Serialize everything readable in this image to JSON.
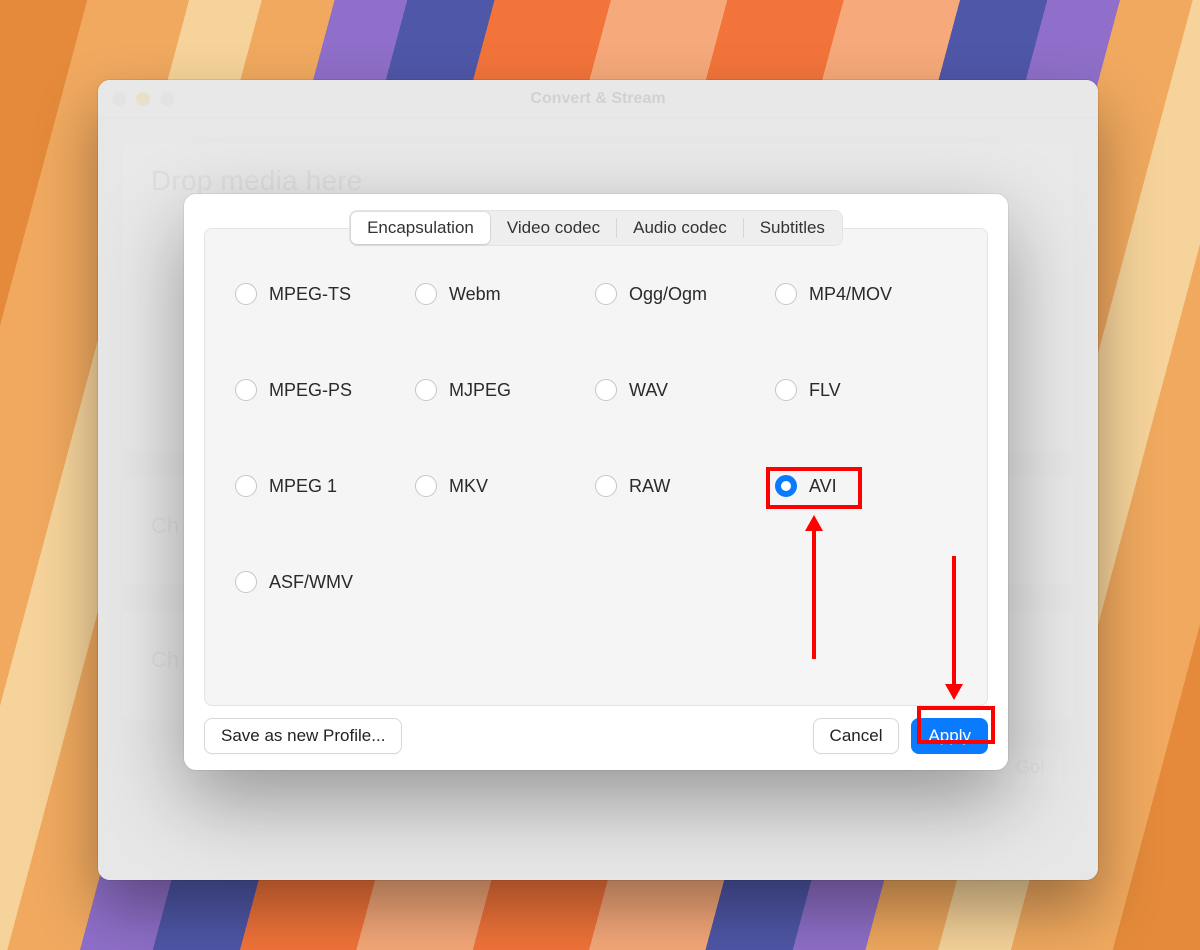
{
  "parent_window": {
    "title": "Convert & Stream",
    "drop_text": "Drop media here",
    "section_prefix": "Ch",
    "go_label": "Go!"
  },
  "sheet": {
    "tabs": {
      "encapsulation": "Encapsulation",
      "video_codec": "Video codec",
      "audio_codec": "Audio codec",
      "subtitles": "Subtitles",
      "active": "encapsulation"
    },
    "encapsulation_options": [
      {
        "id": "mpeg-ts",
        "label": "MPEG-TS",
        "selected": false
      },
      {
        "id": "webm",
        "label": "Webm",
        "selected": false
      },
      {
        "id": "ogg",
        "label": "Ogg/Ogm",
        "selected": false
      },
      {
        "id": "mp4",
        "label": "MP4/MOV",
        "selected": false
      },
      {
        "id": "mpeg-ps",
        "label": "MPEG-PS",
        "selected": false
      },
      {
        "id": "mjpeg",
        "label": "MJPEG",
        "selected": false
      },
      {
        "id": "wav",
        "label": "WAV",
        "selected": false
      },
      {
        "id": "flv",
        "label": "FLV",
        "selected": false
      },
      {
        "id": "mpeg1",
        "label": "MPEG 1",
        "selected": false
      },
      {
        "id": "mkv",
        "label": "MKV",
        "selected": false
      },
      {
        "id": "raw",
        "label": "RAW",
        "selected": false
      },
      {
        "id": "avi",
        "label": "AVI",
        "selected": true
      },
      {
        "id": "asf",
        "label": "ASF/WMV",
        "selected": false
      }
    ],
    "buttons": {
      "save_profile": "Save as new Profile...",
      "cancel": "Cancel",
      "apply": "Apply"
    }
  },
  "colors": {
    "accent": "#0a7bff",
    "annotation": "#ff0000"
  }
}
